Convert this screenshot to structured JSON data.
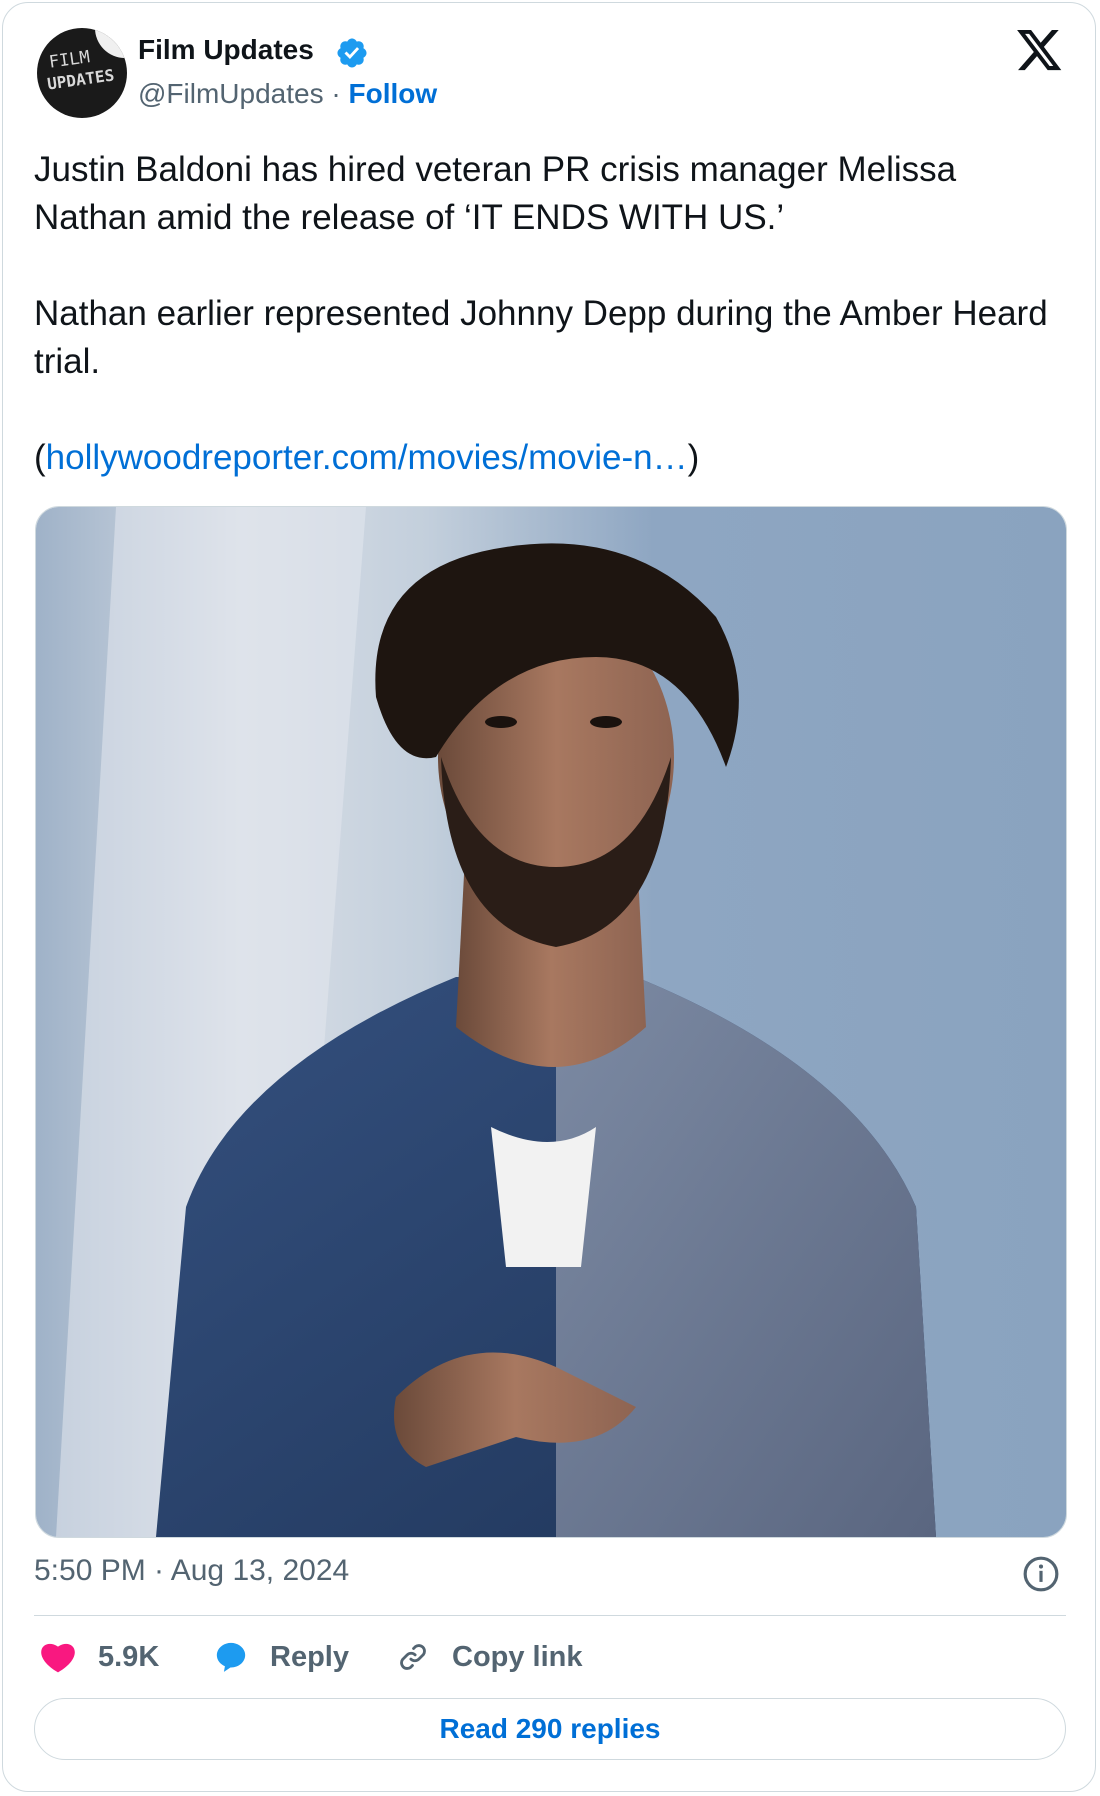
{
  "author": {
    "name": "Film Updates",
    "handle": "@FilmUpdates",
    "separator": " · ",
    "follow_label": "Follow",
    "avatar_text_line1": "FILM",
    "avatar_text_line2": "UPDATES"
  },
  "tweet": {
    "paragraph1": "Justin Baldoni has hired veteran PR crisis manager Melissa Nathan amid the release of ‘IT ENDS WITH US.’",
    "paragraph2": "Nathan earlier represented Johnny Depp during the Amber Heard trial.",
    "link_open": "(",
    "link_text": "hollywoodreporter.com/movies/movie-n…",
    "link_close": ")"
  },
  "meta": {
    "timestamp": "5:50 PM · Aug 13, 2024"
  },
  "actions": {
    "likes": "5.9K",
    "reply_label": "Reply",
    "copy_label": "Copy link"
  },
  "footer": {
    "read_replies_label": "Read 290 replies"
  },
  "colors": {
    "link": "#006fd6",
    "like": "#f91880",
    "reply_bubble": "#1d9bf0",
    "muted": "#536471",
    "border": "#cfd9de"
  },
  "icons": [
    "verified-badge-icon",
    "x-logo-icon",
    "info-icon",
    "heart-icon",
    "speech-bubble-icon",
    "link-icon"
  ]
}
